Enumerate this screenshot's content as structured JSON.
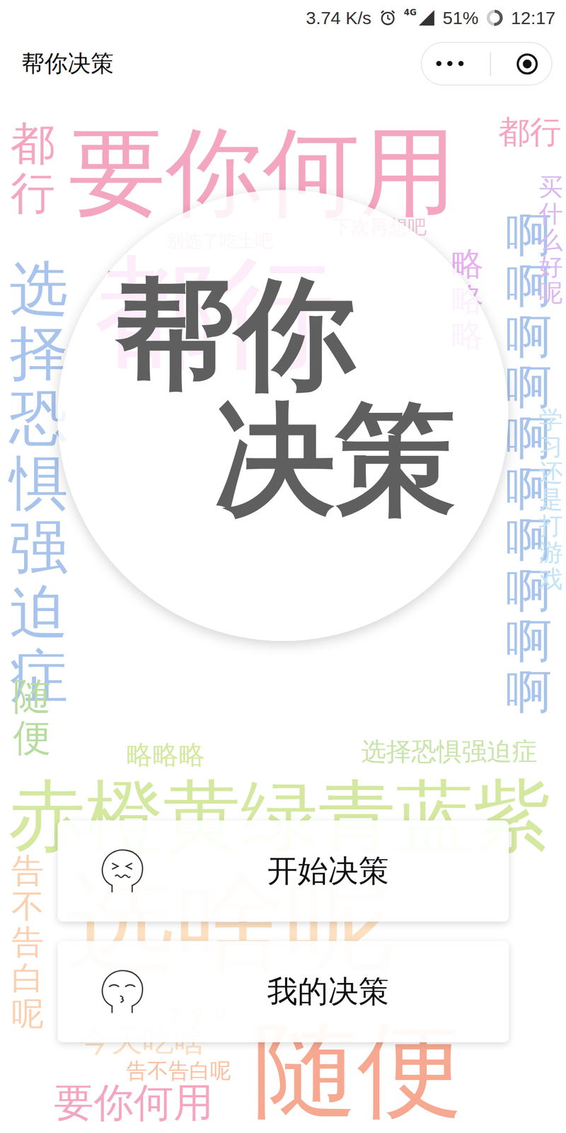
{
  "status_bar": {
    "speed": "3.74 K/s",
    "network": "4G",
    "battery": "51%",
    "battery_level": 0.51,
    "time": "12:17"
  },
  "nav": {
    "title": "帮你决策",
    "menu_icon": "•••"
  },
  "logo": {
    "lines": [
      "帮你",
      "决策"
    ]
  },
  "buttons": [
    {
      "label": "开始决策",
      "kind": "squint"
    },
    {
      "label": "我的决策",
      "kind": "kiss"
    }
  ],
  "word_cloud": [
    {
      "text": "要你何用",
      "color": "#f4a6c0",
      "kind": "horizontal"
    },
    {
      "text": "都行",
      "color": "#f4a6c0",
      "kind": "horizontal"
    },
    {
      "text": "都行",
      "color": "#f4a6c0",
      "kind": "vertical"
    },
    {
      "text": "都行",
      "color": "#f08ad8",
      "kind": "horizontal"
    },
    {
      "text": "选择恐惧强迫症",
      "color": "#a8c4ec",
      "kind": "vertical"
    },
    {
      "text": "随便",
      "color": "#b8dca0",
      "kind": "vertical"
    },
    {
      "text": "啊啊啊啊啊啊啊啊啊啊",
      "color": "#a8c4ec",
      "kind": "vertical"
    },
    {
      "text": "买什么好呢",
      "color": "#d8b8f0",
      "kind": "vertical"
    },
    {
      "text": "学习还是打游戏",
      "color": "#c4e4f4",
      "kind": "vertical"
    },
    {
      "text": "略略略",
      "color": "#e8b0f0",
      "kind": "vertical"
    },
    {
      "text": "赤橙黄绿青蓝紫",
      "color": "#d4e8a0",
      "kind": "horizontal"
    },
    {
      "text": "选择恐惧强迫症",
      "color": "#c8e4a8",
      "kind": "horizontal"
    },
    {
      "text": "略略略",
      "color": "#d4e8a0",
      "kind": "horizontal"
    },
    {
      "text": "选啥呢",
      "color": "#fde0c0",
      "kind": "horizontal"
    },
    {
      "text": "随便",
      "color": "#f7a890",
      "kind": "horizontal"
    },
    {
      "text": "要你何用",
      "color": "#f4a6c0",
      "kind": "horizontal"
    },
    {
      "text": "告不告白呢",
      "color": "#fbd0b0",
      "kind": "vertical"
    },
    {
      "text": "告不告白呢",
      "color": "#fbc0a0",
      "kind": "horizontal"
    },
    {
      "text": "今天吃啥",
      "color": "#fde0c0",
      "kind": "horizontal"
    },
    {
      "text": "下次再想吧",
      "color": "#f4c0d8",
      "kind": "horizontal"
    },
    {
      "text": "别选了吃土吧",
      "color": "#f4c0d8",
      "kind": "horizontal"
    },
    {
      "text": "？？？",
      "color": "#fbd0b0",
      "kind": "horizontal"
    }
  ]
}
